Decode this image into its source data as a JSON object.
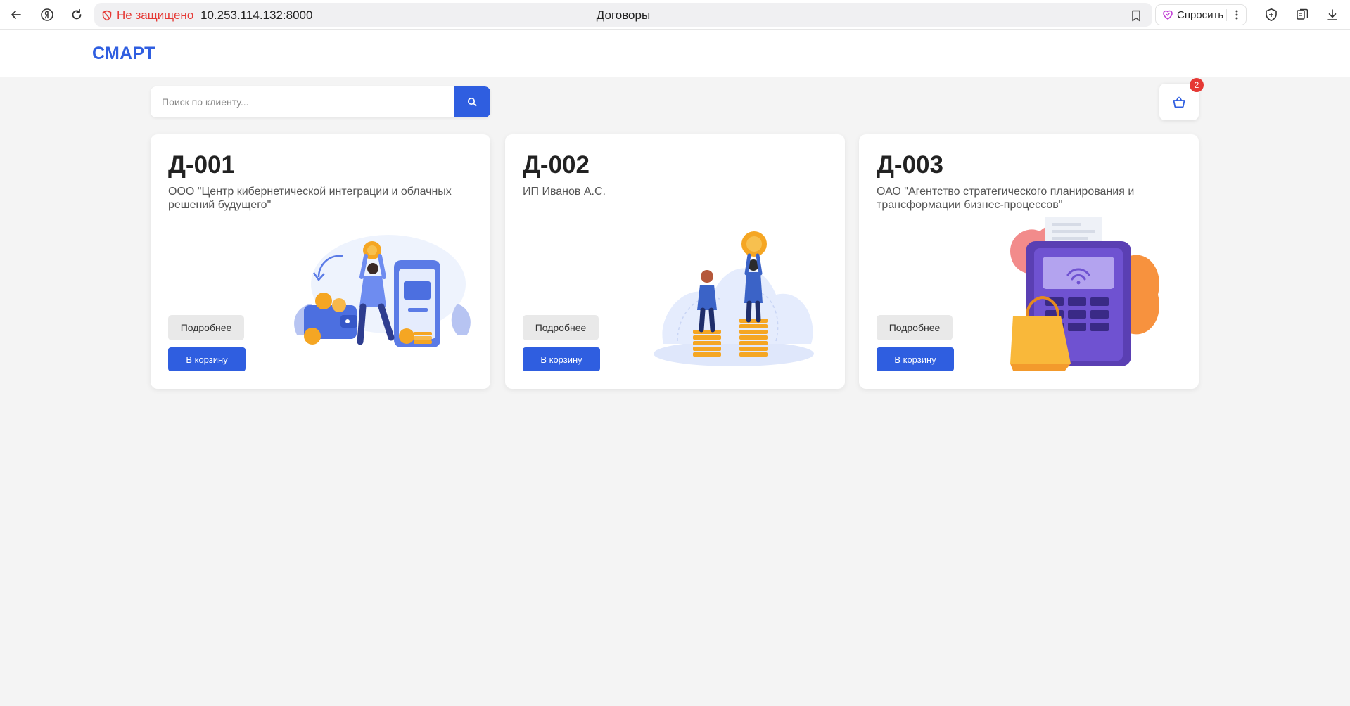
{
  "browser": {
    "insecure_label": "Не защищено",
    "url": "10.253.114.132:8000",
    "tab_title": "Договоры",
    "ask_label": "Спросить"
  },
  "site": {
    "logo": "СМАРТ"
  },
  "search": {
    "placeholder": "Поиск по клиенту..."
  },
  "cart": {
    "count": "2"
  },
  "contracts": [
    {
      "code": "Д-001",
      "client": "ООО \"Центр кибернетической интеграции и облачных решений будущего\"",
      "details_label": "Подробнее",
      "cart_label": "В корзину"
    },
    {
      "code": "Д-002",
      "client": "ИП Иванов А.С.",
      "details_label": "Подробнее",
      "cart_label": "В корзину"
    },
    {
      "code": "Д-003",
      "client": "ОАО \"Агентство стратегического планирования и трансформации бизнес-процессов\"",
      "details_label": "Подробнее",
      "cart_label": "В корзину"
    }
  ],
  "colors": {
    "accent": "#2f5ee0",
    "badge": "#e53935",
    "background": "#f4f4f4"
  }
}
